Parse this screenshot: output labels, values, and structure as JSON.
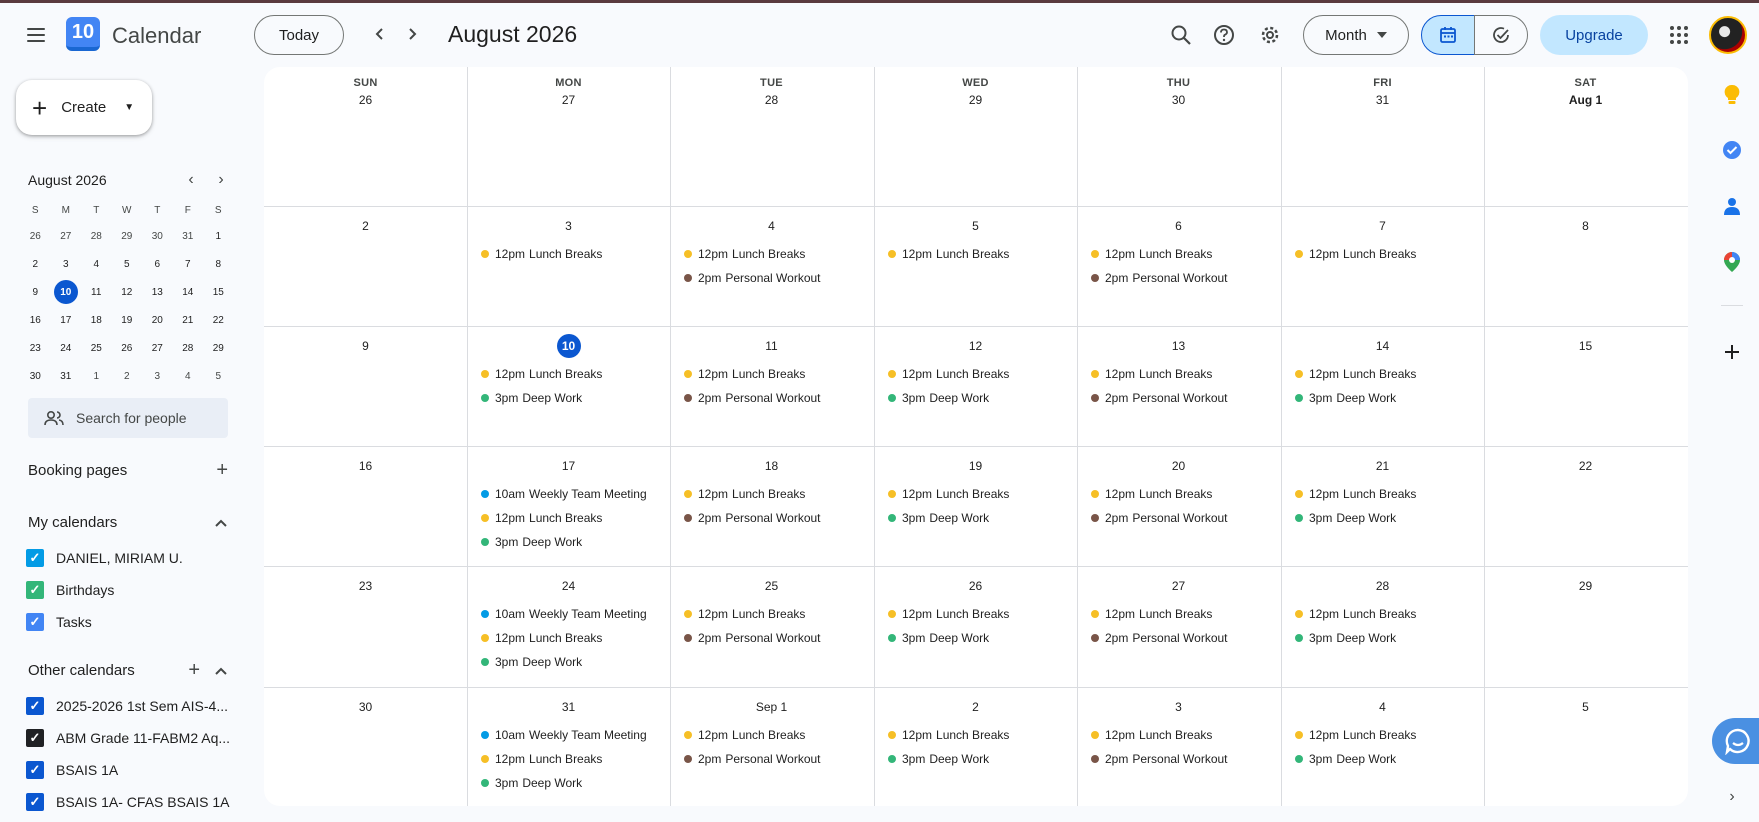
{
  "app": {
    "title": "Calendar",
    "logo_text": "10"
  },
  "header": {
    "today_label": "Today",
    "period_title": "August 2026",
    "view_label": "Month",
    "upgrade_label": "Upgrade"
  },
  "sidebar": {
    "create_label": "Create",
    "mini_calendar": {
      "title": "August 2026",
      "weekdays": [
        "S",
        "M",
        "T",
        "W",
        "T",
        "F",
        "S"
      ],
      "days": [
        "26",
        "27",
        "28",
        "29",
        "30",
        "31",
        "1",
        "2",
        "3",
        "4",
        "5",
        "6",
        "7",
        "8",
        "9",
        "10",
        "11",
        "12",
        "13",
        "14",
        "15",
        "16",
        "17",
        "18",
        "19",
        "20",
        "21",
        "22",
        "23",
        "24",
        "25",
        "26",
        "27",
        "28",
        "29",
        "30",
        "31",
        "1",
        "2",
        "3",
        "4",
        "5"
      ],
      "today_index": 15
    },
    "search_people_placeholder": "Search for people",
    "booking_pages_label": "Booking pages",
    "my_calendars_label": "My calendars",
    "my_calendars": [
      {
        "name": "DANIEL, MIRIAM U.",
        "color": "#039be5"
      },
      {
        "name": "Birthdays",
        "color": "#33b679"
      },
      {
        "name": "Tasks",
        "color": "#4285f4"
      }
    ],
    "other_calendars_label": "Other calendars",
    "other_calendars": [
      {
        "name": "2025-2026 1st Sem AIS-4...",
        "color": "#0b57d0"
      },
      {
        "name": "ABM Grade 11-FABM2 Aq...",
        "color": "#202124"
      },
      {
        "name": "BSAIS 1A",
        "color": "#0b57d0"
      },
      {
        "name": "BSAIS 1A- CFAS BSAIS 1A",
        "color": "#0b57d0"
      }
    ]
  },
  "month_grid": {
    "weekdays": [
      "SUN",
      "MON",
      "TUE",
      "WED",
      "THU",
      "FRI",
      "SAT"
    ],
    "header_days": [
      "26",
      "27",
      "28",
      "29",
      "30",
      "31",
      "Aug 1"
    ],
    "weeks": [
      [
        "2",
        "3",
        "4",
        "5",
        "6",
        "7",
        "8"
      ],
      [
        "9",
        "10",
        "11",
        "12",
        "13",
        "14",
        "15"
      ],
      [
        "16",
        "17",
        "18",
        "19",
        "20",
        "21",
        "22"
      ],
      [
        "23",
        "24",
        "25",
        "26",
        "27",
        "28",
        "29"
      ],
      [
        "30",
        "31",
        "Sep 1",
        "2",
        "3",
        "4",
        "5"
      ]
    ],
    "today": {
      "week": 1,
      "day": 1
    },
    "event_types": {
      "lunch": {
        "time": "12pm",
        "title": "Lunch Breaks",
        "color": "#f6bf26"
      },
      "workout": {
        "time": "2pm",
        "title": "Personal Workout",
        "color": "#795548"
      },
      "deep": {
        "time": "3pm",
        "title": "Deep Work",
        "color": "#33b679"
      },
      "meeting": {
        "time": "10am",
        "title": "Weekly Team Meeting",
        "color": "#039be5"
      }
    },
    "events": [
      [
        [],
        [
          "lunch"
        ],
        [
          "lunch",
          "workout"
        ],
        [
          "lunch"
        ],
        [
          "lunch",
          "workout"
        ],
        [
          "lunch"
        ],
        []
      ],
      [
        [],
        [
          "lunch",
          "deep"
        ],
        [
          "lunch",
          "workout"
        ],
        [
          "lunch",
          "deep"
        ],
        [
          "lunch",
          "workout"
        ],
        [
          "lunch",
          "deep"
        ],
        []
      ],
      [
        [],
        [
          "meeting",
          "lunch",
          "deep"
        ],
        [
          "lunch",
          "workout"
        ],
        [
          "lunch",
          "deep"
        ],
        [
          "lunch",
          "workout"
        ],
        [
          "lunch",
          "deep"
        ],
        []
      ],
      [
        [],
        [
          "meeting",
          "lunch",
          "deep"
        ],
        [
          "lunch",
          "workout"
        ],
        [
          "lunch",
          "deep"
        ],
        [
          "lunch",
          "workout"
        ],
        [
          "lunch",
          "deep"
        ],
        []
      ],
      [
        [],
        [
          "meeting",
          "lunch",
          "deep"
        ],
        [
          "lunch",
          "workout"
        ],
        [
          "lunch",
          "deep"
        ],
        [
          "lunch",
          "workout"
        ],
        [
          "lunch",
          "deep"
        ],
        []
      ]
    ]
  }
}
